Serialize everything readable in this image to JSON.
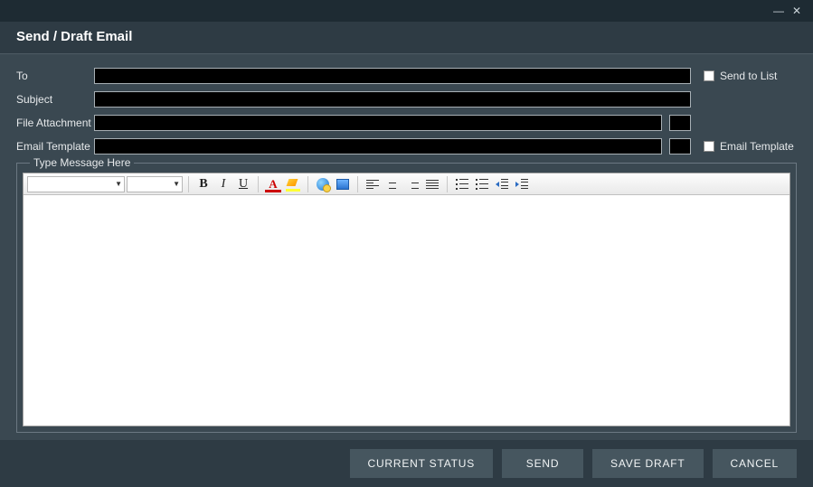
{
  "window": {
    "title": "Send / Draft Email"
  },
  "form": {
    "to_label": "To",
    "to_value": "",
    "subject_label": "Subject",
    "subject_value": "",
    "attachment_label": "File Attachment",
    "attachment_value": "",
    "template_label": "Email Template",
    "template_value": "",
    "send_to_list_label": "Send to List",
    "email_template_chk_label": "Email Template",
    "message_group_label": "Type Message Here"
  },
  "editor": {
    "font_family": "",
    "font_size": "",
    "body": ""
  },
  "buttons": {
    "current_status": "CURRENT STATUS",
    "send": "SEND",
    "save_draft": "SAVE DRAFT",
    "cancel": "CANCEL"
  },
  "icons": {
    "minimize": "—",
    "close": "✕",
    "dropdown": "▼",
    "bold": "B",
    "italic": "I",
    "underline": "U",
    "font_color": "A"
  }
}
